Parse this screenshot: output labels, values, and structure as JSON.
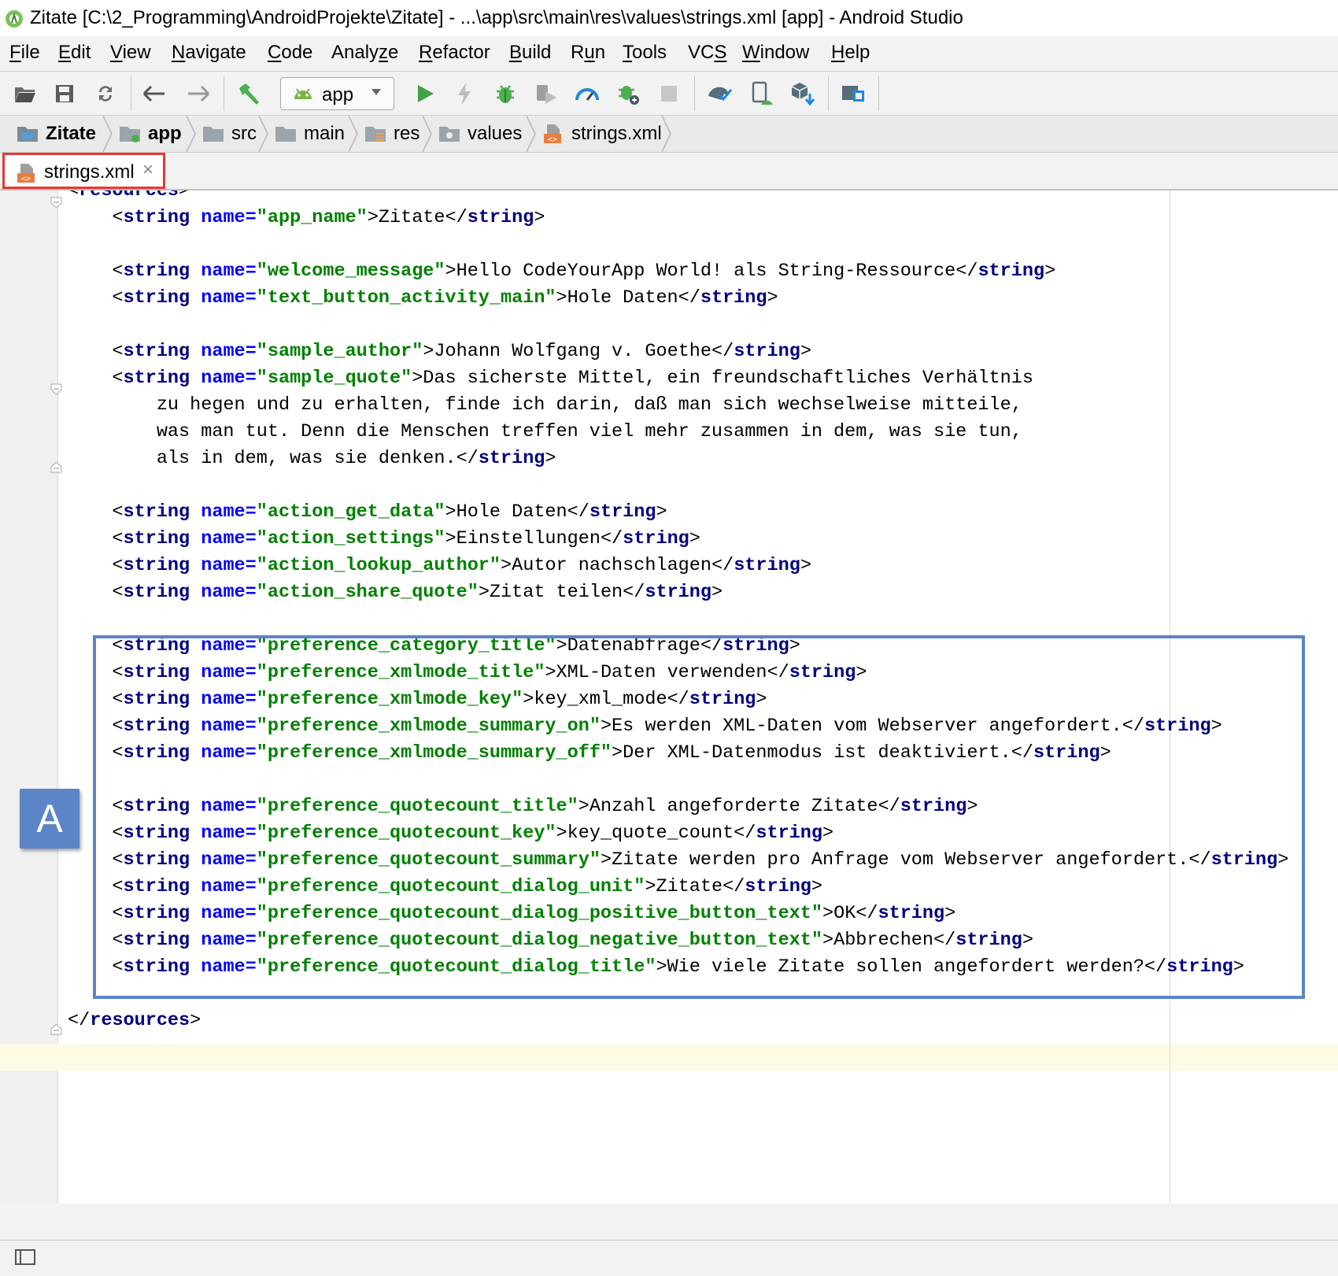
{
  "window": {
    "title": "Zitate [C:\\2_Programming\\AndroidProjekte\\Zitate] - ...\\app\\src\\main\\res\\values\\strings.xml [app] - Android Studio",
    "app_icon": "android-studio-icon"
  },
  "menu": [
    {
      "mnemonic": "F",
      "rest": "ile"
    },
    {
      "mnemonic": "E",
      "rest": "dit"
    },
    {
      "mnemonic": "V",
      "rest": "iew"
    },
    {
      "mnemonic": "N",
      "rest": "avigate"
    },
    {
      "mnemonic": "C",
      "rest": "ode"
    },
    {
      "mnemonic": "",
      "rest": "Analy",
      "mn2": "z",
      "rest2": "e"
    },
    {
      "mnemonic": "R",
      "rest": "efactor"
    },
    {
      "mnemonic": "B",
      "rest": "uild"
    },
    {
      "mnemonic": "",
      "rest": "R",
      "mn2": "u",
      "rest2": "n"
    },
    {
      "mnemonic": "T",
      "rest": "ools"
    },
    {
      "mnemonic": "",
      "rest": "VC",
      "mn2": "S",
      "rest2": ""
    },
    {
      "mnemonic": "W",
      "rest": "indow"
    },
    {
      "mnemonic": "H",
      "rest": "elp"
    }
  ],
  "toolbar": {
    "run_config": "app",
    "icons": [
      "open-folder-icon",
      "save-icon",
      "sync-icon",
      "back-icon",
      "forward-icon",
      "make-project-icon",
      "run-icon",
      "apply-changes-icon",
      "debug-icon",
      "attach-debugger-icon",
      "profile-icon",
      "debug-app-icon",
      "stop-icon",
      "gradle-sync-icon",
      "avd-manager-icon",
      "sdk-manager-icon",
      "project-structure-icon"
    ]
  },
  "breadcrumb": {
    "items": [
      {
        "label": "Zitate",
        "bold": true,
        "icon": "project-folder-icon"
      },
      {
        "label": "app",
        "bold": true,
        "icon": "module-folder-icon"
      },
      {
        "label": "src",
        "bold": false,
        "icon": "folder-icon"
      },
      {
        "label": "main",
        "bold": false,
        "icon": "folder-icon"
      },
      {
        "label": "res",
        "bold": false,
        "icon": "res-folder-icon"
      },
      {
        "label": "values",
        "bold": false,
        "icon": "values-folder-icon"
      },
      {
        "label": "strings.xml",
        "bold": false,
        "icon": "xml-file-icon"
      }
    ]
  },
  "tab": {
    "label": "strings.xml",
    "close": "×",
    "highlight_color": "#e53935"
  },
  "colors": {
    "tag": "#000080",
    "attr_name": "#0000ff",
    "attr_value": "#008000",
    "annotation": "#5b85c6"
  },
  "annotation": {
    "label": "A"
  },
  "code_lines": [
    [
      [
        "t",
        "<"
      ],
      [
        "tg",
        "resources"
      ],
      [
        "t",
        ">"
      ]
    ],
    [
      [
        "t",
        "    <"
      ],
      [
        "tg",
        "string"
      ],
      [
        "t",
        " "
      ],
      [
        "an",
        "name="
      ],
      [
        "av",
        "\"app_name\""
      ],
      [
        "t",
        ">Zitate</"
      ],
      [
        "tg",
        "string"
      ],
      [
        "t",
        ">"
      ]
    ],
    [],
    [
      [
        "t",
        "    <"
      ],
      [
        "tg",
        "string"
      ],
      [
        "t",
        " "
      ],
      [
        "an",
        "name="
      ],
      [
        "av",
        "\"welcome_message\""
      ],
      [
        "t",
        ">Hello CodeYourApp World! als String-Ressource</"
      ],
      [
        "tg",
        "string"
      ],
      [
        "t",
        ">"
      ]
    ],
    [
      [
        "t",
        "    <"
      ],
      [
        "tg",
        "string"
      ],
      [
        "t",
        " "
      ],
      [
        "an",
        "name="
      ],
      [
        "av",
        "\"text_button_activity_main\""
      ],
      [
        "t",
        ">Hole Daten</"
      ],
      [
        "tg",
        "string"
      ],
      [
        "t",
        ">"
      ]
    ],
    [],
    [
      [
        "t",
        "    <"
      ],
      [
        "tg",
        "string"
      ],
      [
        "t",
        " "
      ],
      [
        "an",
        "name="
      ],
      [
        "av",
        "\"sample_author\""
      ],
      [
        "t",
        ">Johann Wolfgang v. Goethe</"
      ],
      [
        "tg",
        "string"
      ],
      [
        "t",
        ">"
      ]
    ],
    [
      [
        "t",
        "    <"
      ],
      [
        "tg",
        "string"
      ],
      [
        "t",
        " "
      ],
      [
        "an",
        "name="
      ],
      [
        "av",
        "\"sample_quote\""
      ],
      [
        "t",
        ">Das sicherste Mittel, ein freundschaftliches Verhältnis"
      ]
    ],
    [
      [
        "t",
        "        zu hegen und zu erhalten, finde ich darin, daß man sich wechselweise mitteile,"
      ]
    ],
    [
      [
        "t",
        "        was man tut. Denn die Menschen treffen viel mehr zusammen in dem, was sie tun,"
      ]
    ],
    [
      [
        "t",
        "        als in dem, was sie denken.</"
      ],
      [
        "tg",
        "string"
      ],
      [
        "t",
        ">"
      ]
    ],
    [],
    [
      [
        "t",
        "    <"
      ],
      [
        "tg",
        "string"
      ],
      [
        "t",
        " "
      ],
      [
        "an",
        "name="
      ],
      [
        "av",
        "\"action_get_data\""
      ],
      [
        "t",
        ">Hole Daten</"
      ],
      [
        "tg",
        "string"
      ],
      [
        "t",
        ">"
      ]
    ],
    [
      [
        "t",
        "    <"
      ],
      [
        "tg",
        "string"
      ],
      [
        "t",
        " "
      ],
      [
        "an",
        "name="
      ],
      [
        "av",
        "\"action_settings\""
      ],
      [
        "t",
        ">Einstellungen</"
      ],
      [
        "tg",
        "string"
      ],
      [
        "t",
        ">"
      ]
    ],
    [
      [
        "t",
        "    <"
      ],
      [
        "tg",
        "string"
      ],
      [
        "t",
        " "
      ],
      [
        "an",
        "name="
      ],
      [
        "av",
        "\"action_lookup_author\""
      ],
      [
        "t",
        ">Autor nachschlagen</"
      ],
      [
        "tg",
        "string"
      ],
      [
        "t",
        ">"
      ]
    ],
    [
      [
        "t",
        "    <"
      ],
      [
        "tg",
        "string"
      ],
      [
        "t",
        " "
      ],
      [
        "an",
        "name="
      ],
      [
        "av",
        "\"action_share_quote\""
      ],
      [
        "t",
        ">Zitat teilen</"
      ],
      [
        "tg",
        "string"
      ],
      [
        "t",
        ">"
      ]
    ],
    [],
    [
      [
        "t",
        "    <"
      ],
      [
        "tg",
        "string"
      ],
      [
        "t",
        " "
      ],
      [
        "an",
        "name="
      ],
      [
        "av",
        "\"preference_category_title\""
      ],
      [
        "t",
        ">Datenabfrage</"
      ],
      [
        "tg",
        "string"
      ],
      [
        "t",
        ">"
      ]
    ],
    [
      [
        "t",
        "    <"
      ],
      [
        "tg",
        "string"
      ],
      [
        "t",
        " "
      ],
      [
        "an",
        "name="
      ],
      [
        "av",
        "\"preference_xmlmode_title\""
      ],
      [
        "t",
        ">XML-Daten verwenden</"
      ],
      [
        "tg",
        "string"
      ],
      [
        "t",
        ">"
      ]
    ],
    [
      [
        "t",
        "    <"
      ],
      [
        "tg",
        "string"
      ],
      [
        "t",
        " "
      ],
      [
        "an",
        "name="
      ],
      [
        "av",
        "\"preference_xmlmode_key\""
      ],
      [
        "t",
        ">key_xml_mode</"
      ],
      [
        "tg",
        "string"
      ],
      [
        "t",
        ">"
      ]
    ],
    [
      [
        "t",
        "    <"
      ],
      [
        "tg",
        "string"
      ],
      [
        "t",
        " "
      ],
      [
        "an",
        "name="
      ],
      [
        "av",
        "\"preference_xmlmode_summary_on\""
      ],
      [
        "t",
        ">Es werden XML-Daten vom Webserver angefordert.</"
      ],
      [
        "tg",
        "string"
      ],
      [
        "t",
        ">"
      ]
    ],
    [
      [
        "t",
        "    <"
      ],
      [
        "tg",
        "string"
      ],
      [
        "t",
        " "
      ],
      [
        "an",
        "name="
      ],
      [
        "av",
        "\"preference_xmlmode_summary_off\""
      ],
      [
        "t",
        ">Der XML-Datenmodus ist deaktiviert.</"
      ],
      [
        "tg",
        "string"
      ],
      [
        "t",
        ">"
      ]
    ],
    [],
    [
      [
        "t",
        "    <"
      ],
      [
        "tg",
        "string"
      ],
      [
        "t",
        " "
      ],
      [
        "an",
        "name="
      ],
      [
        "av",
        "\"preference_quotecount_title\""
      ],
      [
        "t",
        ">Anzahl angeforderte Zitate</"
      ],
      [
        "tg",
        "string"
      ],
      [
        "t",
        ">"
      ]
    ],
    [
      [
        "t",
        "    <"
      ],
      [
        "tg",
        "string"
      ],
      [
        "t",
        " "
      ],
      [
        "an",
        "name="
      ],
      [
        "av",
        "\"preference_quotecount_key\""
      ],
      [
        "t",
        ">key_quote_count</"
      ],
      [
        "tg",
        "string"
      ],
      [
        "t",
        ">"
      ]
    ],
    [
      [
        "t",
        "    <"
      ],
      [
        "tg",
        "string"
      ],
      [
        "t",
        " "
      ],
      [
        "an",
        "name="
      ],
      [
        "av",
        "\"preference_quotecount_summary\""
      ],
      [
        "t",
        ">Zitate werden pro Anfrage vom Webserver angefordert.</"
      ],
      [
        "tg",
        "string"
      ],
      [
        "t",
        ">"
      ]
    ],
    [
      [
        "t",
        "    <"
      ],
      [
        "tg",
        "string"
      ],
      [
        "t",
        " "
      ],
      [
        "an",
        "name="
      ],
      [
        "av",
        "\"preference_quotecount_dialog_unit\""
      ],
      [
        "t",
        ">Zitate</"
      ],
      [
        "tg",
        "string"
      ],
      [
        "t",
        ">"
      ]
    ],
    [
      [
        "t",
        "    <"
      ],
      [
        "tg",
        "string"
      ],
      [
        "t",
        " "
      ],
      [
        "an",
        "name="
      ],
      [
        "av",
        "\"preference_quotecount_dialog_positive_button_text\""
      ],
      [
        "t",
        ">OK</"
      ],
      [
        "tg",
        "string"
      ],
      [
        "t",
        ">"
      ]
    ],
    [
      [
        "t",
        "    <"
      ],
      [
        "tg",
        "string"
      ],
      [
        "t",
        " "
      ],
      [
        "an",
        "name="
      ],
      [
        "av",
        "\"preference_quotecount_dialog_negative_button_text\""
      ],
      [
        "t",
        ">Abbrechen</"
      ],
      [
        "tg",
        "string"
      ],
      [
        "t",
        ">"
      ]
    ],
    [
      [
        "t",
        "    <"
      ],
      [
        "tg",
        "string"
      ],
      [
        "t",
        " "
      ],
      [
        "an",
        "name="
      ],
      [
        "av",
        "\"preference_quotecount_dialog_title\""
      ],
      [
        "t",
        ">Wie viele Zitate sollen angefordert werden?</"
      ],
      [
        "tg",
        "string"
      ],
      [
        "t",
        ">"
      ]
    ],
    [],
    [
      [
        "t",
        "</"
      ],
      [
        "tg",
        "resources"
      ],
      [
        "t",
        ">"
      ]
    ]
  ]
}
